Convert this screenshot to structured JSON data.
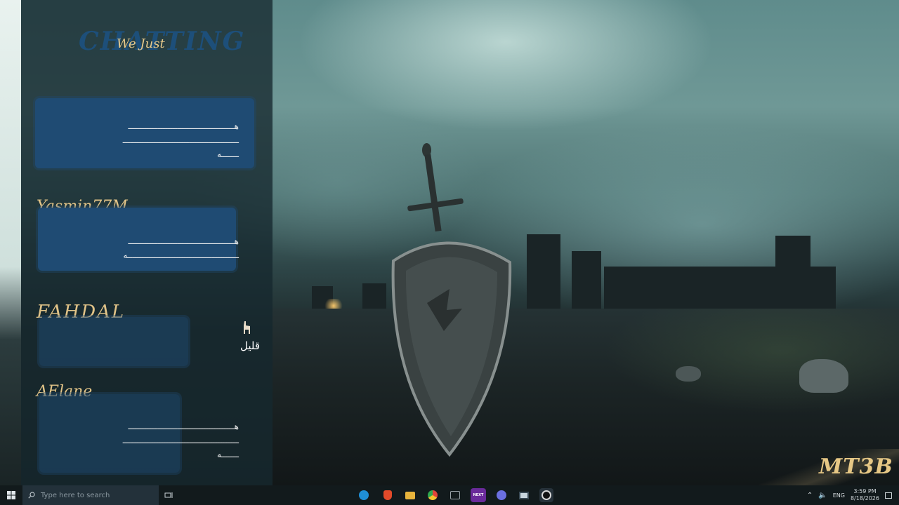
{
  "chat": {
    "room_logo_back": "CHATTING",
    "room_logo_front": "We Just",
    "messages": [
      {
        "username": "",
        "text": "هـــــــــــــــــــــــــــــــــــــــــــ\nـــــــــــــــــــــــــــــــــــــــــــــــ\nـــــــه"
      },
      {
        "username": "Yasmin77M",
        "text": "هـــــــــــــــــــــــــــــــــــــــــــ\nـــــــــــــــــــــــــــــــــــــــــــــه"
      },
      {
        "username": "FAHDAL",
        "text": "قليل"
      },
      {
        "username": "AElane",
        "text": "هـــــــــــــــــــــــــــــــــــــــــــ\nـــــــــــــــــــــــــــــــــــــــــــــــ\nـــــــه"
      }
    ]
  },
  "wallpaper": {
    "signature": "MT3B"
  },
  "taskbar": {
    "search_placeholder": "Type here to search",
    "apps": [
      {
        "name": "edge-icon",
        "color": "#1f8fd6",
        "label": ""
      },
      {
        "name": "brave-icon",
        "color": "#e24a2a",
        "label": ""
      },
      {
        "name": "file-explorer-icon",
        "color": "#e8b43c",
        "label": ""
      },
      {
        "name": "chrome-icon",
        "color": "#e0443a",
        "label": ""
      },
      {
        "name": "xbox-app-icon",
        "color": "#2f3a40",
        "label": ""
      },
      {
        "name": "next-app-icon",
        "color": "#6a2a9a",
        "label": "NEXT"
      },
      {
        "name": "discord-icon",
        "color": "#6b6fe0",
        "label": ""
      },
      {
        "name": "window-app-icon",
        "color": "#3a4a55",
        "label": ""
      },
      {
        "name": "obs-icon",
        "color": "#2a2a2a",
        "label": ""
      }
    ],
    "tray": {
      "language": "ENG",
      "time": "3:59 PM",
      "date": "8/18/2026"
    }
  }
}
